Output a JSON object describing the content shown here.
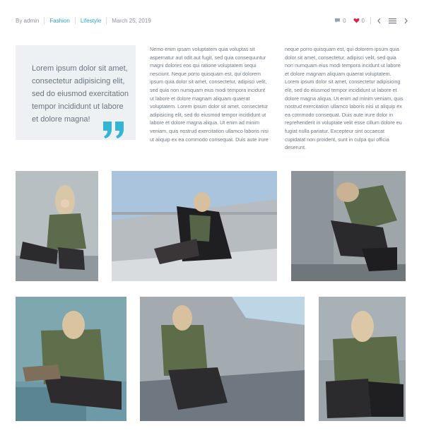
{
  "meta": {
    "author": "By admin",
    "category1": "Fashion",
    "category2": "Lifestyle",
    "date": "March 25, 2019",
    "comments": "0",
    "likes": "0"
  },
  "quote": {
    "text": "Lorem ipsum dolor sit amet, consectetur adipisicing elit, sed do eiusmod exercitation tempor incididunt ut labore et dolore magna!"
  },
  "body": {
    "col1": "Nemo enim ipsam voluptatem quia voluptas sit aspernatur aut odit aut fugit, sed quia consequuntur magni dolores eos qui ratione voluptatem sequi nesciunt. Neque porro quisquam est, qui dolorem ipsum quia dolor sit amet, consectetur, adipisci velit, sed quia non numquam eius modi tempora incidunt ut labore et dolore magnam aliquam quaerat voluptatem. Lorem ipsum dolor sit amet, consectetur adipisicing elit, sed do eiusmod tempor incididunt ut labore et dolore magna aliqua. Ut enim ad minim veniam, quis nostrud exercitation ullamco laboris nisi ut aliquip ex ea commodo consequat. Duis aute irure",
    "col2": "neque porro quisquam est, qui dolorem ipsum quia dolor sit amet, consectetur, adipisci velit, sed quia non numquam eius modi tempora incidunt ut labore et dolore magnam aliquam quaerat voluptatem. Lorem ipsum dolor sit amet, consectetur adipisicing elit, sed do eiusmod tempor incididunt ut labore et dolore magna aliqua. Ut enim ad minim veniam, quis nostrud exercitation ullamco laboris nisi ut aliquip ex ea commodo consequat. Duis aute irure dolor in reprehenderit in voluptate velit esse cillum dolore eu fugiat nulla pariatur. Excepteur sint occaecat cupidatat non proident, sunt in culpa qui officia deserunt."
  },
  "icons": {
    "comment": "comment-icon",
    "like": "heart-icon",
    "prev": "chevron-left-icon",
    "menu": "grid-menu-icon",
    "next": "chevron-right-icon",
    "quote": "quote-mark-icon"
  },
  "colors": {
    "accent": "#2aa6c9",
    "heart": "#e0204a",
    "quote_bg": "#eef1f4"
  }
}
